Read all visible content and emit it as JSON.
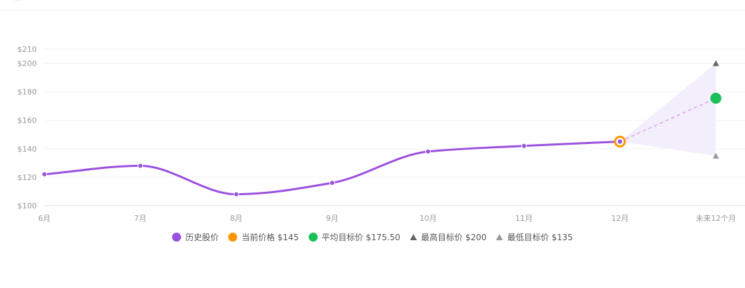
{
  "chart_data": {
    "type": "line",
    "categories": [
      "6月",
      "7月",
      "8月",
      "9月",
      "10月",
      "11月",
      "12月",
      "未来12个月"
    ],
    "ytick_labels": [
      "$100",
      "$120",
      "$140",
      "$160",
      "$180",
      "$200",
      "$210"
    ],
    "ylim": [
      100,
      210
    ],
    "grid": true,
    "legend_position": "bottom",
    "series": [
      {
        "name": "历史股价",
        "values": [
          122,
          128,
          108,
          116,
          138,
          142,
          145
        ]
      }
    ],
    "current_price": 145,
    "forecast": {
      "average": 175.5,
      "high": 200,
      "low": 135
    },
    "legend": {
      "history": "历史股价",
      "current": "当前价格 $145",
      "average": "平均目标价 $175.50",
      "high": "最高目标价 $200",
      "low": "最低目标价 $135"
    },
    "colors": {
      "history": "#9b51e0",
      "current": "#ff9500",
      "average": "#1cc05b",
      "high": "#666666",
      "low": "#9a9a9a",
      "band": "#f3eefc",
      "grid": "#f2f2f2"
    }
  }
}
